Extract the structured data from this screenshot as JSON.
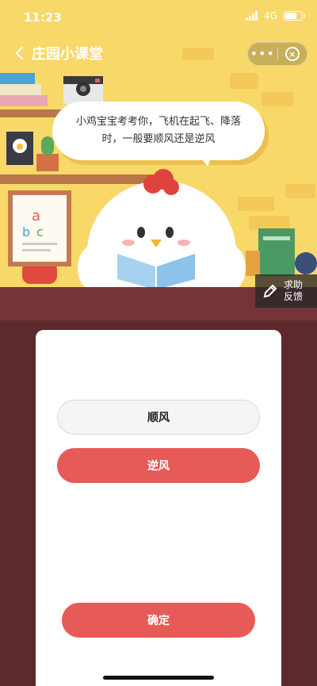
{
  "status_bar": {
    "time": "11:23",
    "network": "4G"
  },
  "nav": {
    "title": "庄园小课堂",
    "more_label": "•••",
    "close_label": "×"
  },
  "scene": {
    "question": "小鸡宝宝考考你，飞机在起飞、降落时，一般要顺风还是逆风",
    "poster_text": "abc"
  },
  "help": {
    "line1": "求助",
    "line2": "反馈"
  },
  "quiz": {
    "options": [
      {
        "label": "顺风"
      },
      {
        "label": "逆风"
      }
    ],
    "confirm_label": "确定"
  },
  "colors": {
    "scene_bg": "#f8d869",
    "floor": "#5c2a2c",
    "accent_red": "#e65b57",
    "card_bg": "#ffffff"
  }
}
